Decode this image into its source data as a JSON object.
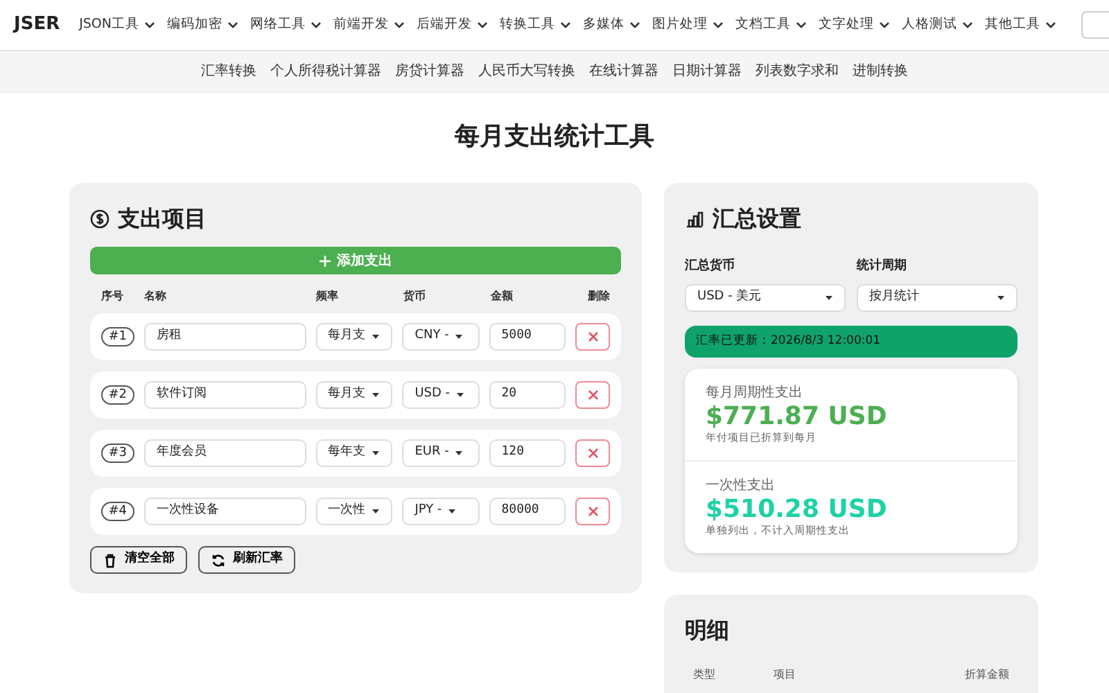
{
  "brand": "JSER",
  "nav_menu": [
    "JSON工具",
    "编码加密",
    "网络工具",
    "前端开发",
    "后端开发",
    "转换工具",
    "多媒体",
    "图片处理",
    "文档工具",
    "文字处理",
    "人格测试",
    "其他工具"
  ],
  "sub_nav": [
    "汇率转换",
    "个人所得税计算器",
    "房贷计算器",
    "人民币大写转换",
    "在线计算器",
    "日期计算器",
    "列表数字求和",
    "进制转换"
  ],
  "page_title": "每月支出统计工具",
  "expenses": {
    "title": "支出项目",
    "add_button": "添加支出",
    "columns": [
      "序号",
      "名称",
      "频率",
      "货币",
      "金额",
      "删除"
    ],
    "rows": [
      {
        "index": "#1",
        "name": "房租",
        "frequency": "每月支",
        "currency": "CNY -",
        "amount": "5000"
      },
      {
        "index": "#2",
        "name": "软件订阅",
        "frequency": "每月支",
        "currency": "USD -",
        "amount": "20"
      },
      {
        "index": "#3",
        "name": "年度会员",
        "frequency": "每年支",
        "currency": "EUR -",
        "amount": "120"
      },
      {
        "index": "#4",
        "name": "一次性设备",
        "frequency": "一次性",
        "currency": "JPY -",
        "amount": "80000"
      }
    ],
    "buttons": [
      {
        "kind": "clear",
        "label": "清空全部"
      },
      {
        "kind": "refresh",
        "label": "刷新汇率"
      }
    ]
  },
  "summary": {
    "title": "汇总设置",
    "currency_label": "汇总货币",
    "currency_value": "USD - 美元",
    "period_label": "统计周期",
    "period_value": "按月统计",
    "rate_status": "汇率已更新：2026/8/3 12:00:01",
    "totals": [
      {
        "label": "每月周期性支出",
        "value": "$771.87 USD",
        "note": "年付项目已折算到每月",
        "color": "#4caf50"
      },
      {
        "label": "一次性支出",
        "value": "$510.28 USD",
        "note": "单独列出，不计入周期性支出",
        "color": "#1fd1a5"
      }
    ]
  },
  "details": {
    "title": "明细",
    "columns": [
      "类型",
      "项目",
      "折算金额"
    ]
  }
}
